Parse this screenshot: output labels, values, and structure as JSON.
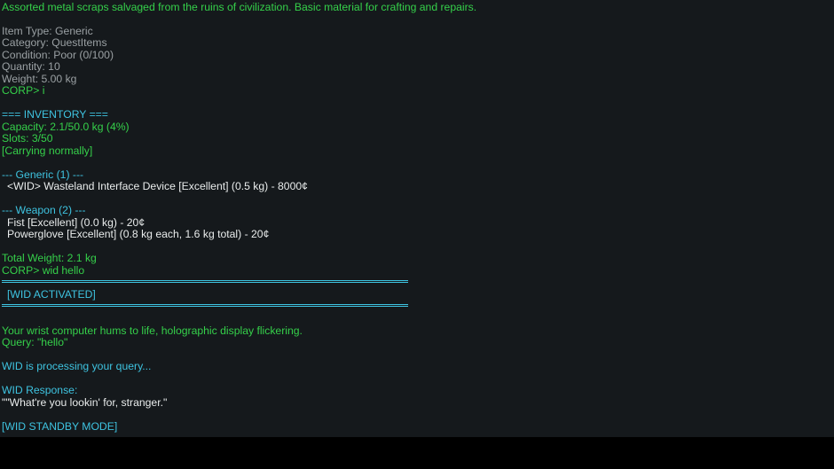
{
  "colors": {
    "background": "#15191c",
    "green": "#35d04a",
    "gray": "#9aa0a3",
    "cyan": "#3ec3e0",
    "white": "#e9ecec"
  },
  "item": {
    "description": "Assorted metal scraps salvaged from the ruins of civilization. Basic material for crafting and repairs.",
    "type": "Item Type: Generic",
    "category": "Category: QuestItems",
    "condition": "Condition: Poor (0/100)",
    "quantity": "Quantity: 10",
    "weight": "Weight: 5.00 kg"
  },
  "commands": {
    "inventory": "CORP> i",
    "wid_hello": "CORP> wid hello"
  },
  "inventory": {
    "header": "=== INVENTORY ===",
    "capacity": "Capacity: 2.1/50.0 kg (4%)",
    "slots": "Slots: 3/50",
    "status": "[Carrying normally]",
    "generic_header": "--- Generic (1) ---",
    "generic_items": [
      "<WID> Wasteland Interface Device [Excellent] (0.5 kg) - 8000¢"
    ],
    "weapon_header": "--- Weapon (2) ---",
    "weapon_items": [
      "Fist [Excellent] (0.0 kg) - 20¢",
      "Powerglove [Excellent] (0.8 kg each, 1.6 kg total) - 20¢"
    ],
    "total_weight": "Total Weight: 2.1 kg"
  },
  "wid": {
    "activated": "[WID ACTIVATED]",
    "hum": "Your wrist computer hums to life, holographic display flickering.",
    "query": "Query: \"hello\"",
    "processing": "WID is processing your query...",
    "response_label": "WID Response:",
    "response": "\"\"What're you lookin' for, stranger.\"",
    "standby": "[WID STANDBY MODE]"
  }
}
